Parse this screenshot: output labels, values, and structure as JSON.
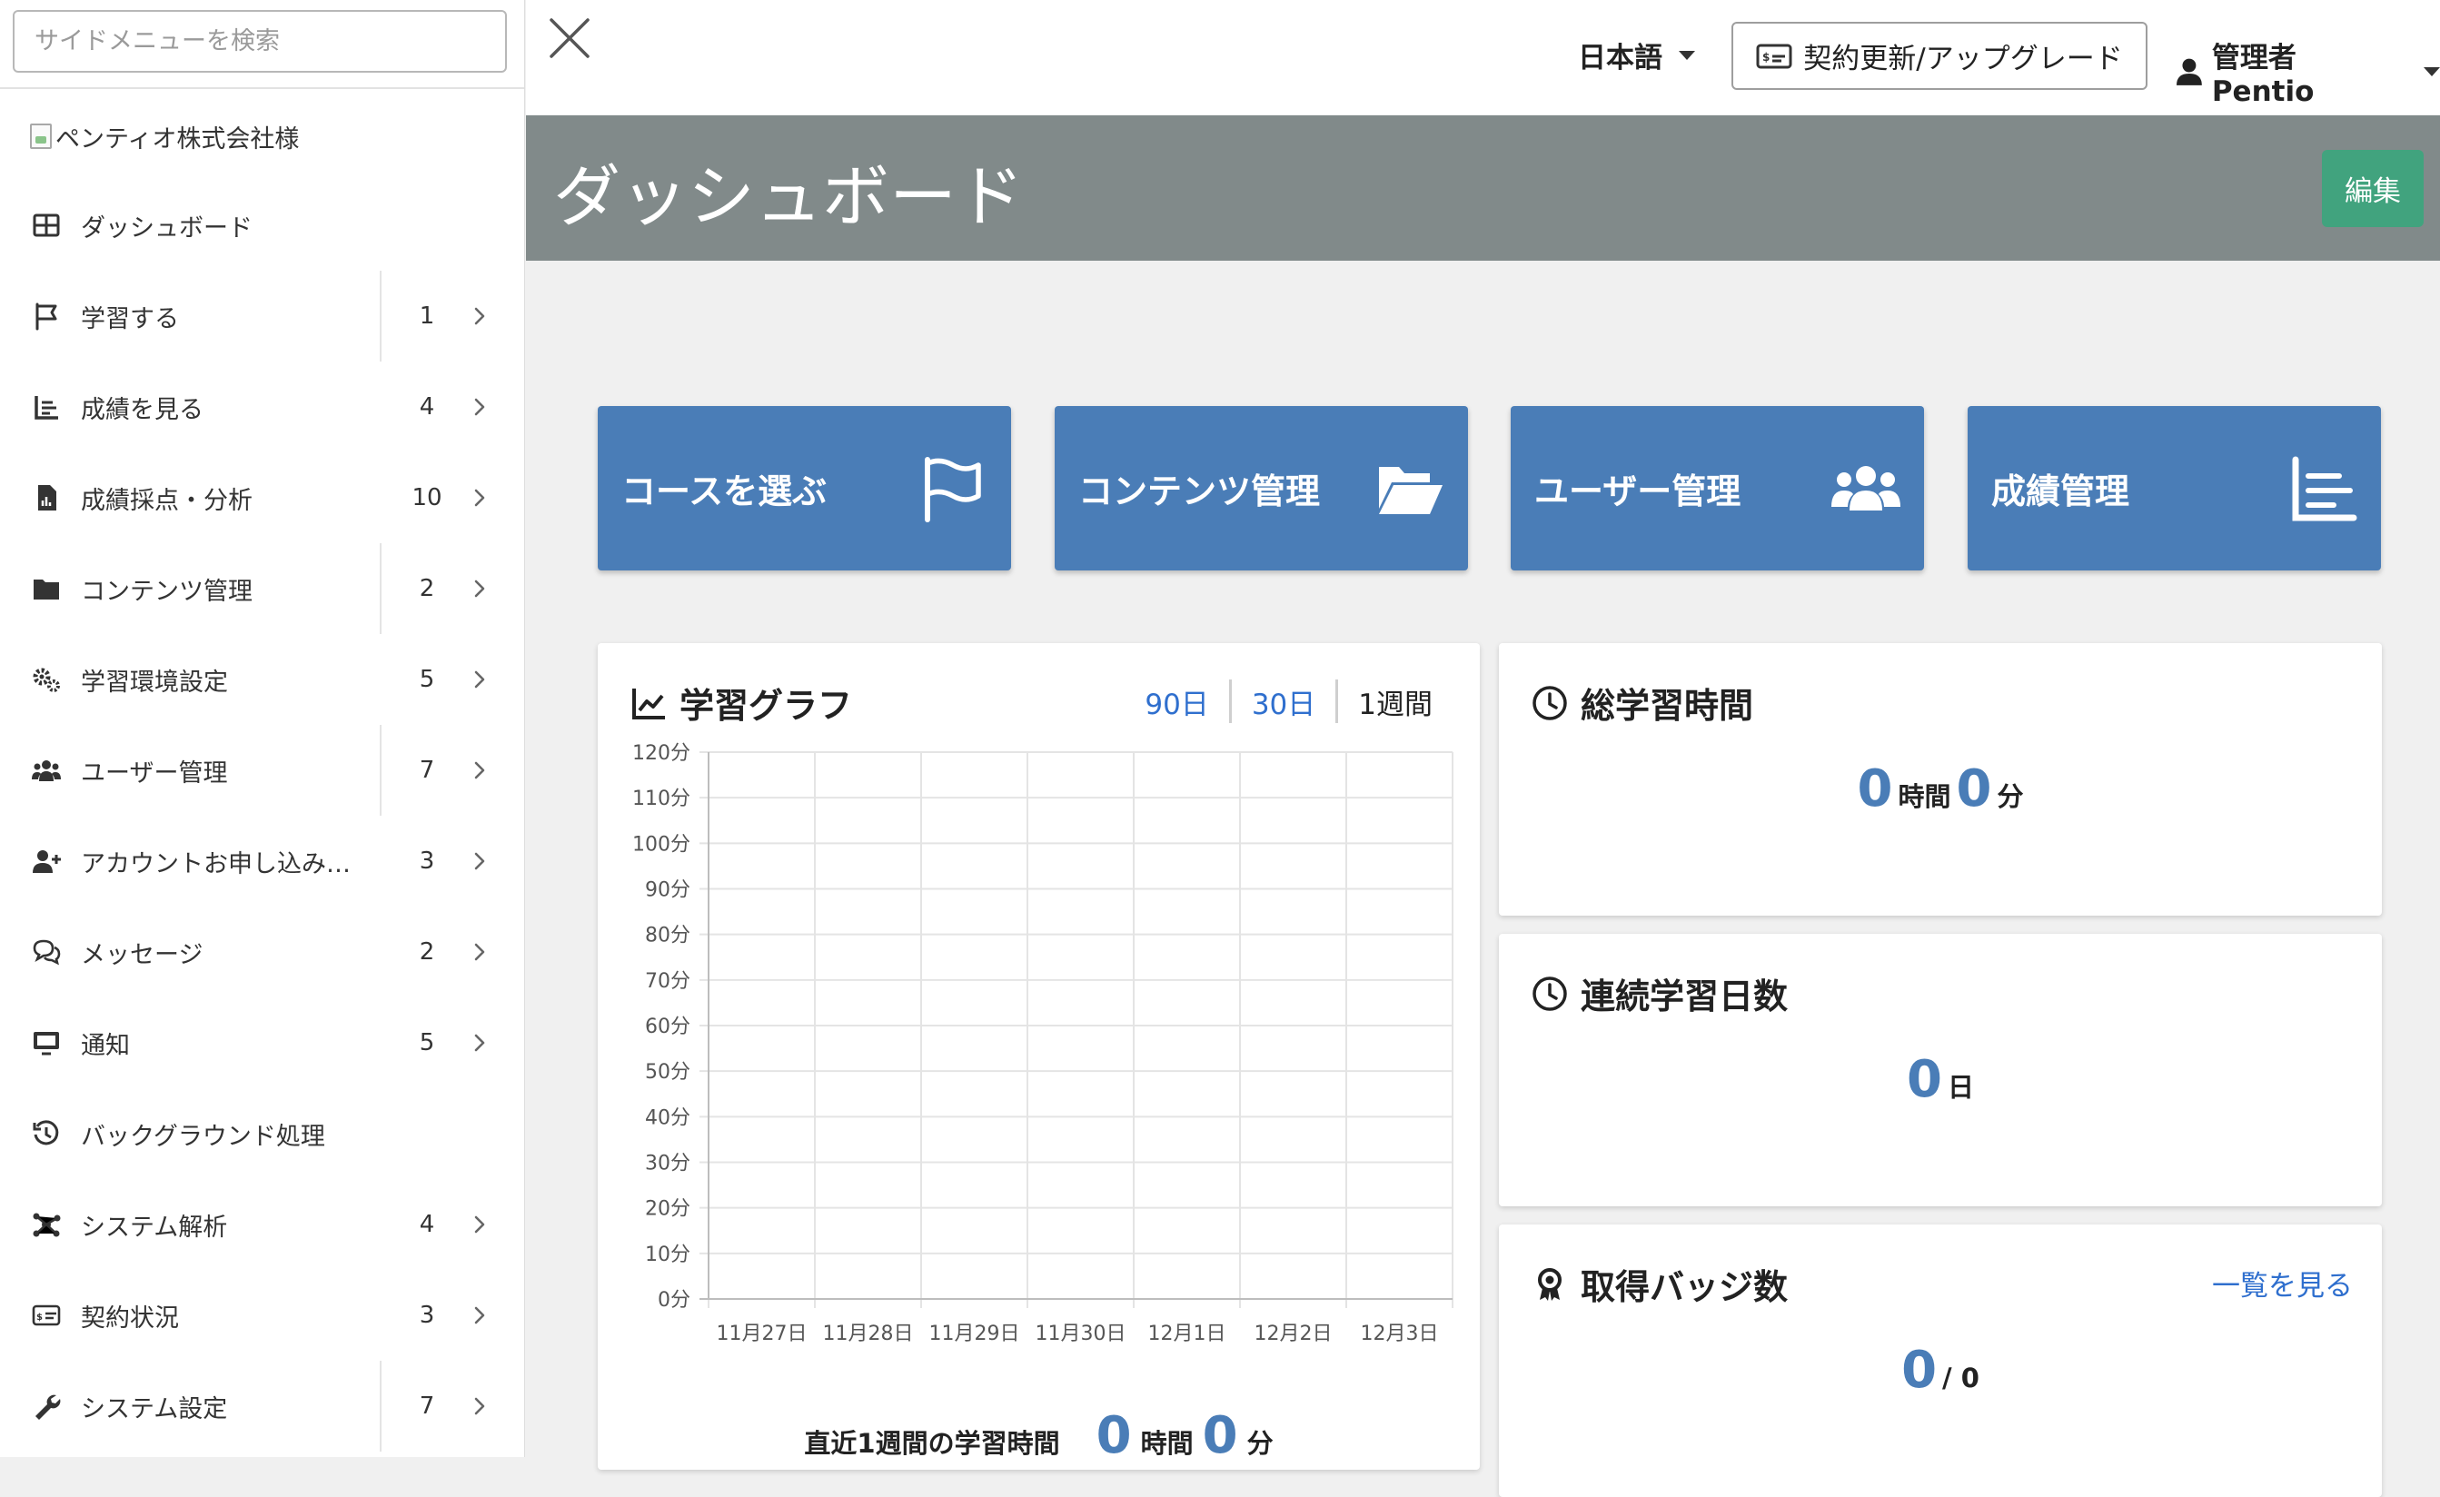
{
  "sidebar": {
    "search_placeholder": "サイドメニューを検索",
    "org_name": "ペンティオ株式会社様",
    "items": [
      {
        "label": "ダッシュボード",
        "icon": "table-grid-icon",
        "count": "",
        "chevron": false
      },
      {
        "label": "学習する",
        "icon": "flag-icon",
        "count": "1",
        "chevron": true
      },
      {
        "label": "成績を見る",
        "icon": "bar-chart-icon",
        "count": "4",
        "chevron": true
      },
      {
        "label": "成績採点・分析",
        "icon": "file-chart-icon",
        "count": "10",
        "chevron": true
      },
      {
        "label": "コンテンツ管理",
        "icon": "folder-icon",
        "count": "2",
        "chevron": true
      },
      {
        "label": "学習環境設定",
        "icon": "gears-icon",
        "count": "5",
        "chevron": true
      },
      {
        "label": "ユーザー管理",
        "icon": "users-icon",
        "count": "7",
        "chevron": true
      },
      {
        "label": "アカウントお申し込み…",
        "icon": "user-plus-icon",
        "count": "3",
        "chevron": true
      },
      {
        "label": "メッセージ",
        "icon": "comments-icon",
        "count": "2",
        "chevron": true
      },
      {
        "label": "通知",
        "icon": "monitor-icon",
        "count": "5",
        "chevron": true
      },
      {
        "label": "バックグラウンド処理",
        "icon": "history-icon",
        "count": "",
        "chevron": false
      },
      {
        "label": "システム解析",
        "icon": "hub-icon",
        "count": "4",
        "chevron": true
      },
      {
        "label": "契約状況",
        "icon": "license-card-icon",
        "count": "3",
        "chevron": true
      },
      {
        "label": "システム設定",
        "icon": "wrench-icon",
        "count": "7",
        "chevron": true
      }
    ]
  },
  "topbar": {
    "language": "日本語",
    "upgrade_label": "契約更新/アップグレード",
    "user_label": "管理者 Pentio"
  },
  "header": {
    "title": "ダッシュボード",
    "edit_label": "編集"
  },
  "tiles": [
    {
      "label": "コースを選ぶ",
      "icon": "flag-icon"
    },
    {
      "label": "コンテンツ管理",
      "icon": "folder-open-icon"
    },
    {
      "label": "ユーザー管理",
      "icon": "users-icon"
    },
    {
      "label": "成績管理",
      "icon": "bar-chart-icon"
    }
  ],
  "learning_graph": {
    "title": "学習グラフ",
    "ranges": [
      "90日",
      "30日",
      "1週間"
    ],
    "active_range": "1週間",
    "footer_label": "直近1週間の学習時間",
    "hours": "0",
    "hours_unit": "時間",
    "minutes": "0",
    "minutes_unit": "分"
  },
  "chart_data": {
    "type": "line",
    "title": "",
    "xlabel": "",
    "ylabel": "",
    "categories": [
      "11月27日",
      "11月28日",
      "11月29日",
      "11月30日",
      "12月1日",
      "12月2日",
      "12月3日"
    ],
    "values": [
      0,
      0,
      0,
      0,
      0,
      0,
      0
    ],
    "ylim": [
      0,
      120
    ],
    "y_ticks": [
      "0分",
      "10分",
      "20分",
      "30分",
      "40分",
      "50分",
      "60分",
      "70分",
      "80分",
      "90分",
      "100分",
      "110分",
      "120分"
    ],
    "grid": true
  },
  "total_time": {
    "title": "総学習時間",
    "hours": "0",
    "hours_unit": "時間",
    "minutes": "0",
    "minutes_unit": "分"
  },
  "streak": {
    "title": "連続学習日数",
    "days": "0",
    "days_unit": "日"
  },
  "badges": {
    "title": "取得バッジ数",
    "link_label": "一覧を見る",
    "earned": "0",
    "total": "/ 0"
  },
  "colors": {
    "tile_blue": "#4a7db7",
    "header_gray": "#818a8a",
    "edit_green": "#41a37e",
    "link_blue": "#2f6fce"
  }
}
